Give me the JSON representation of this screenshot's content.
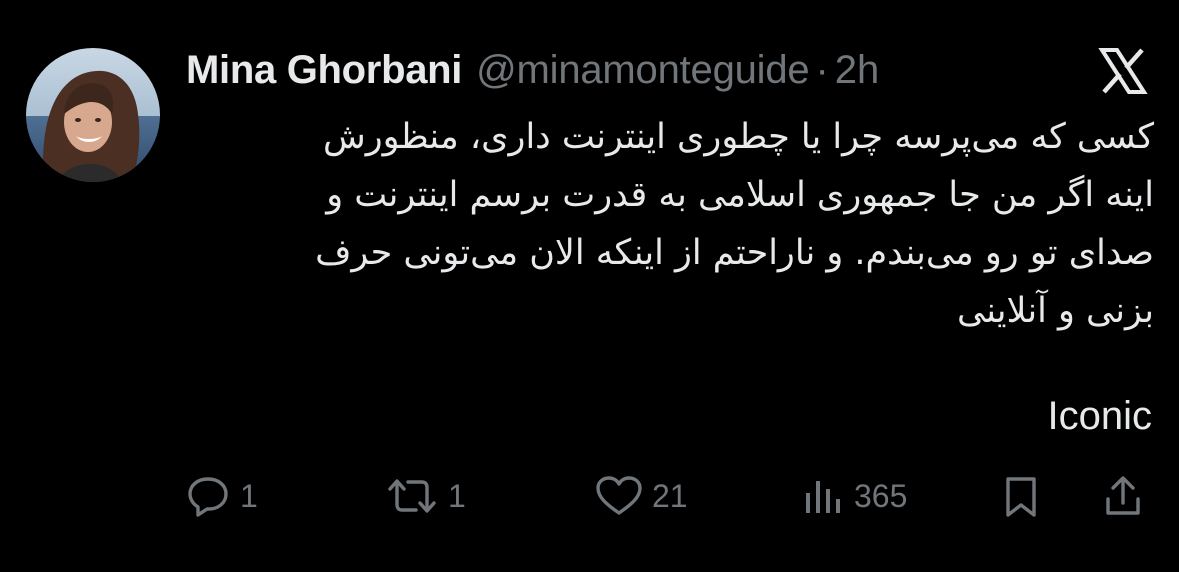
{
  "tweet": {
    "author": {
      "display_name": "Mina Ghorbani",
      "handle": "@minamonteguide",
      "separator": "·",
      "time": "2h"
    },
    "text_lines": [
      "کسی که می‌پرسه چرا یا چطوری اینترنت داری، منظورش",
      "اینه اگر من جا جمهوری اسلامی به قدرت برسم اینترنت و",
      "صدای تو رو می‌بندم. و ناراحتم از اینکه الان می‌تونی حرف",
      "بزنی و آنلاینی"
    ],
    "caption": "Iconic"
  },
  "actions": {
    "reply": {
      "icon": "reply-icon",
      "count": "1"
    },
    "retweet": {
      "icon": "retweet-icon",
      "count": "1"
    },
    "like": {
      "icon": "heart-icon",
      "count": "21"
    },
    "views": {
      "icon": "analytics-icon",
      "count": "365"
    },
    "bookmark": {
      "icon": "bookmark-icon"
    },
    "share": {
      "icon": "share-icon"
    }
  },
  "colors": {
    "background": "#000000",
    "text": "#e7e9ea",
    "secondary": "#71767b"
  }
}
